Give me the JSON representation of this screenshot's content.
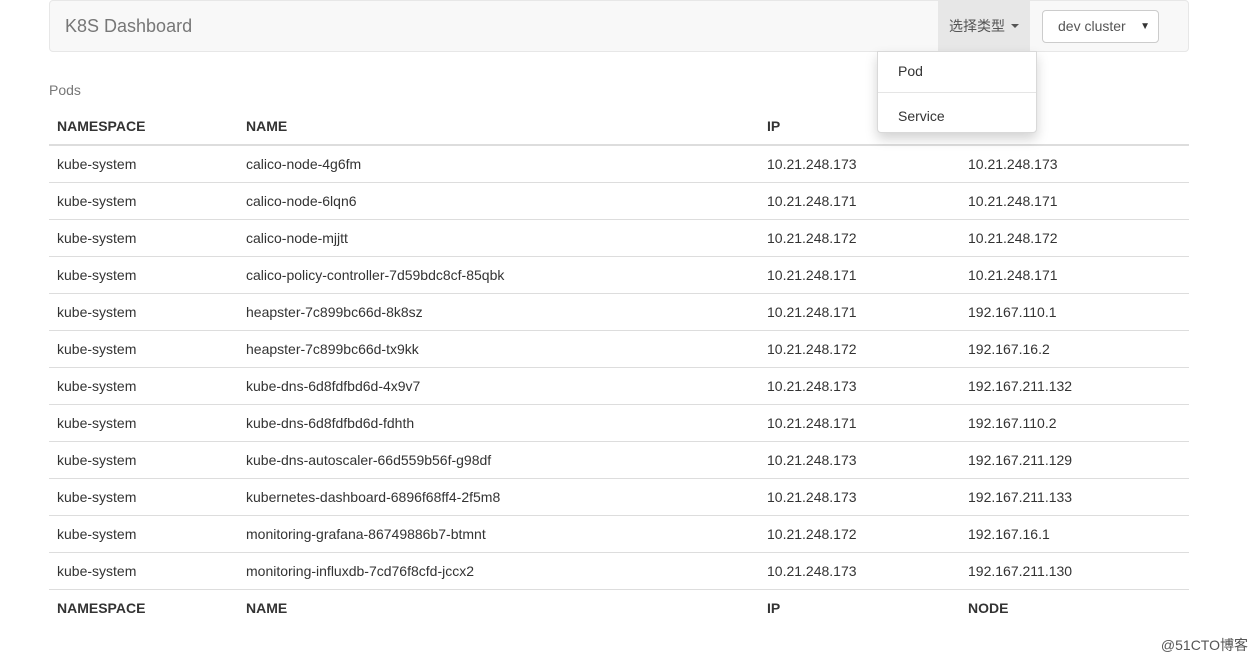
{
  "navbar": {
    "brand": "K8S Dashboard",
    "type_dropdown_label": "选择类型",
    "cluster_select_value": "dev cluster"
  },
  "type_menu": {
    "items": [
      "Pod",
      "Service"
    ]
  },
  "table": {
    "caption": "Pods",
    "headers": [
      "NAMESPACE",
      "NAME",
      "IP",
      "NODE"
    ],
    "rows": [
      [
        "kube-system",
        "calico-node-4g6fm",
        "10.21.248.173",
        "10.21.248.173"
      ],
      [
        "kube-system",
        "calico-node-6lqn6",
        "10.21.248.171",
        "10.21.248.171"
      ],
      [
        "kube-system",
        "calico-node-mjjtt",
        "10.21.248.172",
        "10.21.248.172"
      ],
      [
        "kube-system",
        "calico-policy-controller-7d59bdc8cf-85qbk",
        "10.21.248.171",
        "10.21.248.171"
      ],
      [
        "kube-system",
        "heapster-7c899bc66d-8k8sz",
        "10.21.248.171",
        "192.167.110.1"
      ],
      [
        "kube-system",
        "heapster-7c899bc66d-tx9kk",
        "10.21.248.172",
        "192.167.16.2"
      ],
      [
        "kube-system",
        "kube-dns-6d8fdfbd6d-4x9v7",
        "10.21.248.173",
        "192.167.211.132"
      ],
      [
        "kube-system",
        "kube-dns-6d8fdfbd6d-fdhth",
        "10.21.248.171",
        "192.167.110.2"
      ],
      [
        "kube-system",
        "kube-dns-autoscaler-66d559b56f-g98df",
        "10.21.248.173",
        "192.167.211.129"
      ],
      [
        "kube-system",
        "kubernetes-dashboard-6896f68ff4-2f5m8",
        "10.21.248.173",
        "192.167.211.133"
      ],
      [
        "kube-system",
        "monitoring-grafana-86749886b7-btmnt",
        "10.21.248.172",
        "192.167.16.1"
      ],
      [
        "kube-system",
        "monitoring-influxdb-7cd76f8cfd-jccx2",
        "10.21.248.173",
        "192.167.211.130"
      ]
    ]
  },
  "watermark": "@51CTO博客"
}
